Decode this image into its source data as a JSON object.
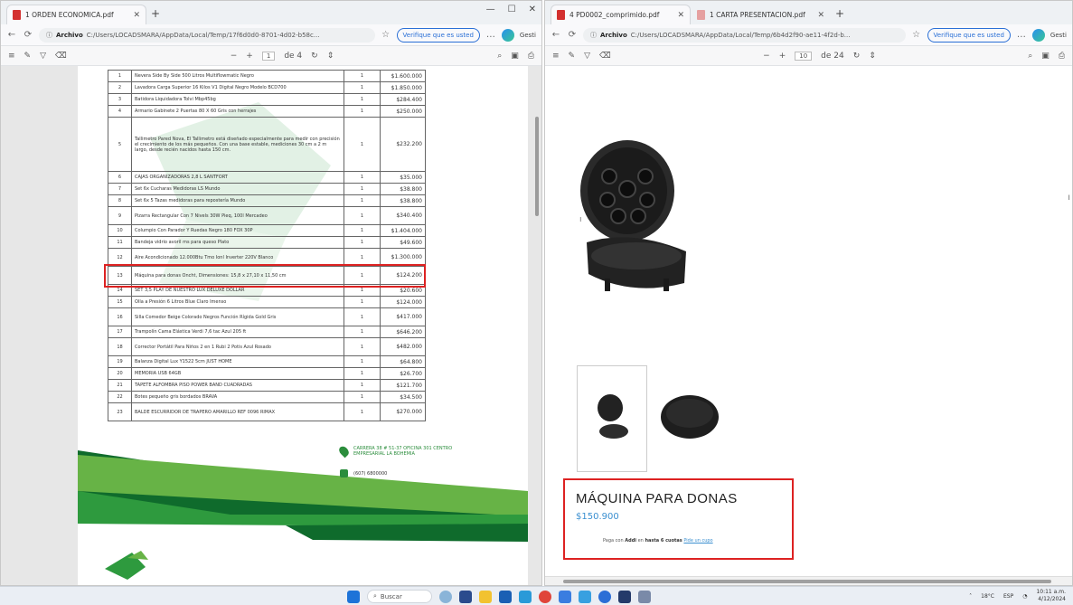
{
  "left_window": {
    "tab_title": "1 ORDEN ECONOMICA.pdf",
    "address_label": "Archivo",
    "address_path": "C:/Users/LOCADSMARA/AppData/Local/Temp/17f6d0d0-8701-4d02-b58c...",
    "verify_label": "Verifique que es usted",
    "user_label": "Gesti",
    "page_number": "1",
    "page_total": "de 4",
    "rows": [
      {
        "n": "1",
        "desc": "Nevera Side By Side 500 Litros Multiflowmatic Negro",
        "qty": "1",
        "price": "$1.600.000"
      },
      {
        "n": "2",
        "desc": "Lavadora Carga Superior 16 Kilos V1 Digital Negro Modelo BCD700",
        "qty": "1",
        "price": "$1.850.000"
      },
      {
        "n": "3",
        "desc": "Batidora Liquidadora Tolvi Mbp45bg",
        "qty": "1",
        "price": "$284.400"
      },
      {
        "n": "4",
        "desc": "Armario Gabinete 2 Puertas 80 X 60 Gris con herrajes",
        "qty": "1",
        "price": "$250.000"
      },
      {
        "n": "5",
        "desc": "Tallimetro Pared Nova, El Tallimetro está diseñado especialmente para medir con precisión el crecimiento de los más pequeños. Con una base estable, mediciones 30 cm a 2 m largo, desde recién nacidos hasta 150 cm.",
        "qty": "1",
        "price": "$232.200",
        "size": "tall"
      },
      {
        "n": "6",
        "desc": "CAJAS ORGANIZADORAS 2,8 L SANTFORT",
        "qty": "1",
        "price": "$35.000"
      },
      {
        "n": "7",
        "desc": "Set 6x Cucharas Medidoras LS Mundo",
        "qty": "1",
        "price": "$38.800"
      },
      {
        "n": "8",
        "desc": "Set 6x 5 Tazas medidoras para repostería Mundo",
        "qty": "1",
        "price": "$38.800"
      },
      {
        "n": "9",
        "desc": "Pizarra Rectangular Con 7 Nivels 30W Pieq, 100l Mercadeo",
        "qty": "1",
        "price": "$340.400",
        "size": "mid"
      },
      {
        "n": "10",
        "desc": "Columpio Con Parador Y Ruedas Negro 180 FOX 30P",
        "qty": "1",
        "price": "$1.404.000"
      },
      {
        "n": "11",
        "desc": "Bandeja vidrio avoril ms para queso Plato",
        "qty": "1",
        "price": "$49.600"
      },
      {
        "n": "12",
        "desc": "Aire Acondicionado 12.000Btu Tmo Ionl Inverter 220V Blanco",
        "qty": "1",
        "price": "$1.300.000",
        "size": "mid"
      },
      {
        "n": "13",
        "desc": "Máquina para donas Oncht, Dimensiones: 15,8 x 27,10 x 11,50 cm",
        "qty": "1",
        "price": "$124.200",
        "size": "mid"
      },
      {
        "n": "14",
        "desc": "SET 3,5 PLAY DE NUESTRO LUX DELUXE DOLLAR",
        "qty": "1",
        "price": "$20.600"
      },
      {
        "n": "15",
        "desc": "Olla a Presión 6 Litros Blue Claro Imenso",
        "qty": "1",
        "price": "$124.000"
      },
      {
        "n": "16",
        "desc": "Silla Comedor Beige Colorado Negros Función Rígida Gold Gris",
        "qty": "1",
        "price": "$417.000",
        "size": "mid"
      },
      {
        "n": "17",
        "desc": "Trampolín Cama Elástica Verdi 7,6 tac Azul 205 ft",
        "qty": "1",
        "price": "$646.200"
      },
      {
        "n": "18",
        "desc": "Corrector Portátil Para Niños 2 en 1 Rubi 2 Potis Azul Rosado",
        "qty": "1",
        "price": "$482.000",
        "size": "mid"
      },
      {
        "n": "19",
        "desc": "Balanza Digital Lux Y1522 5cm JUST HOME",
        "qty": "1",
        "price": "$64.800"
      },
      {
        "n": "20",
        "desc": "MEMORIA USB 64GB",
        "qty": "1",
        "price": "$26.700"
      },
      {
        "n": "21",
        "desc": "TAPETE ALFOMBRA PISO POWER BAND CUADRADAS",
        "qty": "1",
        "price": "$121.700"
      },
      {
        "n": "22",
        "desc": "Botes pequeño gris bordados BRAVA",
        "qty": "1",
        "price": "$34.500"
      },
      {
        "n": "23",
        "desc": "BALDE ESCURRIDOR DE TRAPERO AMARILLO REF 0096 RIMAX",
        "qty": "1",
        "price": "$270.000",
        "size": "mid"
      }
    ],
    "contact_address": "CARRERA 38 # 51-37 OFICINA 301 CENTRO EMPRESARIAL LA BOHEMIA",
    "contact_phone": "(607) 6800000"
  },
  "right_window": {
    "tab_title": "4 PD0002_comprimido.pdf",
    "tab2_title": "1 CARTA PRESENTACION.pdf",
    "address_label": "Archivo",
    "address_path": "C:/Users/LOCADSMARA/AppData/Local/Temp/6b4d2f90-ae11-4f2d-b...",
    "verify_label": "Verifique que es usted",
    "user_label": "Gesti",
    "page_number": "10",
    "page_total": "de 24",
    "product_name": "MÁQUINA PARA DONAS",
    "product_price": "$150.900",
    "pay_text_pre": "Paga con",
    "pay_text_bold": "Addi",
    "pay_text_mid": "en",
    "pay_text_bold2": "hasta 6 cuotas",
    "pay_link": "Pide un cupo"
  },
  "taskbar": {
    "search_label": "Buscar",
    "temperature": "18°C",
    "language": "ESP",
    "time": "10:11 a.m.",
    "date": "4/12/2024"
  },
  "colors": {
    "highlight": "#dd2222",
    "accent_green": "#2b8d3c",
    "link_blue": "#3a8fd0"
  }
}
